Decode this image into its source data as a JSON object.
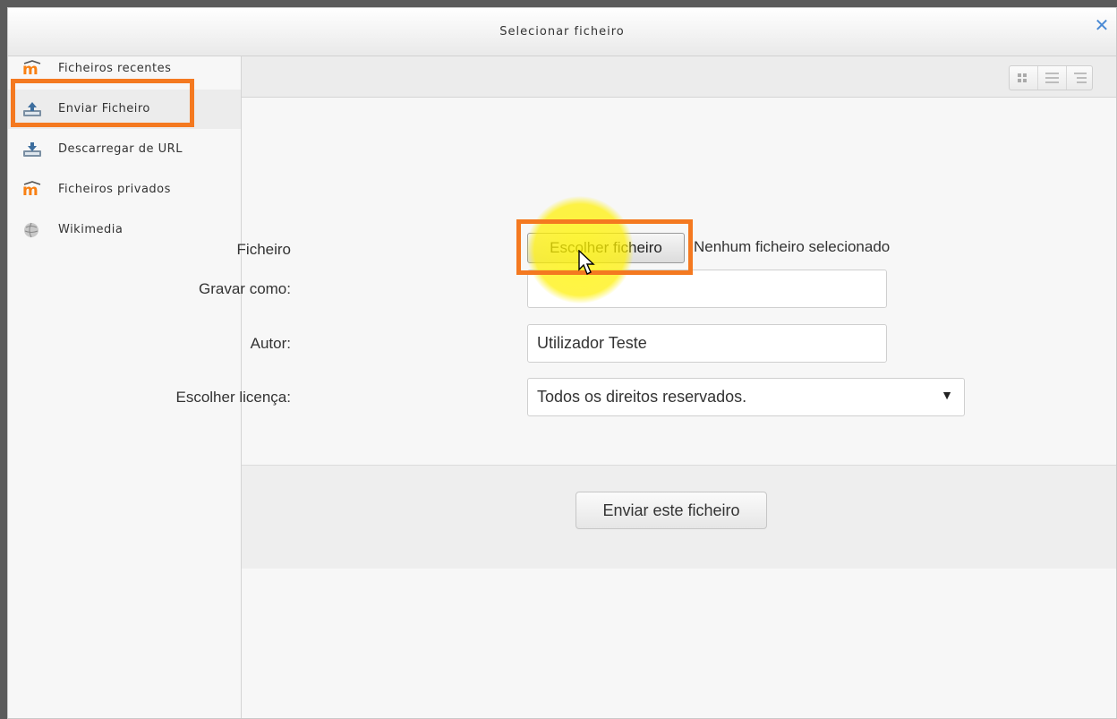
{
  "dialog": {
    "title": "Selecionar ficheiro",
    "close_icon": "close-x-icon"
  },
  "sidebar": {
    "items": [
      {
        "label": "Ficheiros recentes",
        "icon": "moodle-icon",
        "active": false
      },
      {
        "label": "Enviar Ficheiro",
        "icon": "upload-icon",
        "active": true
      },
      {
        "label": "Descarregar de URL",
        "icon": "download-url-icon",
        "active": false
      },
      {
        "label": "Ficheiros privados",
        "icon": "moodle-icon",
        "active": false
      },
      {
        "label": "Wikimedia",
        "icon": "wikimedia-icon",
        "active": false
      }
    ]
  },
  "toolbar": {
    "views": [
      "icon-view",
      "list-view",
      "tree-view"
    ]
  },
  "form": {
    "file_label": "Ficheiro",
    "file_button": "Escolher ficheiro",
    "file_status": "Nenhum ficheiro selecionado",
    "saveas_label": "Gravar como:",
    "saveas_value": "",
    "author_label": "Autor:",
    "author_value": "Utilizador Teste",
    "license_label": "Escolher licença:",
    "license_value": "Todos os direitos reservados."
  },
  "footer": {
    "submit_label": "Enviar este ficheiro"
  },
  "colors": {
    "highlight": "#f47920",
    "close": "#4a8ad4",
    "spotlight": "#fff200"
  }
}
